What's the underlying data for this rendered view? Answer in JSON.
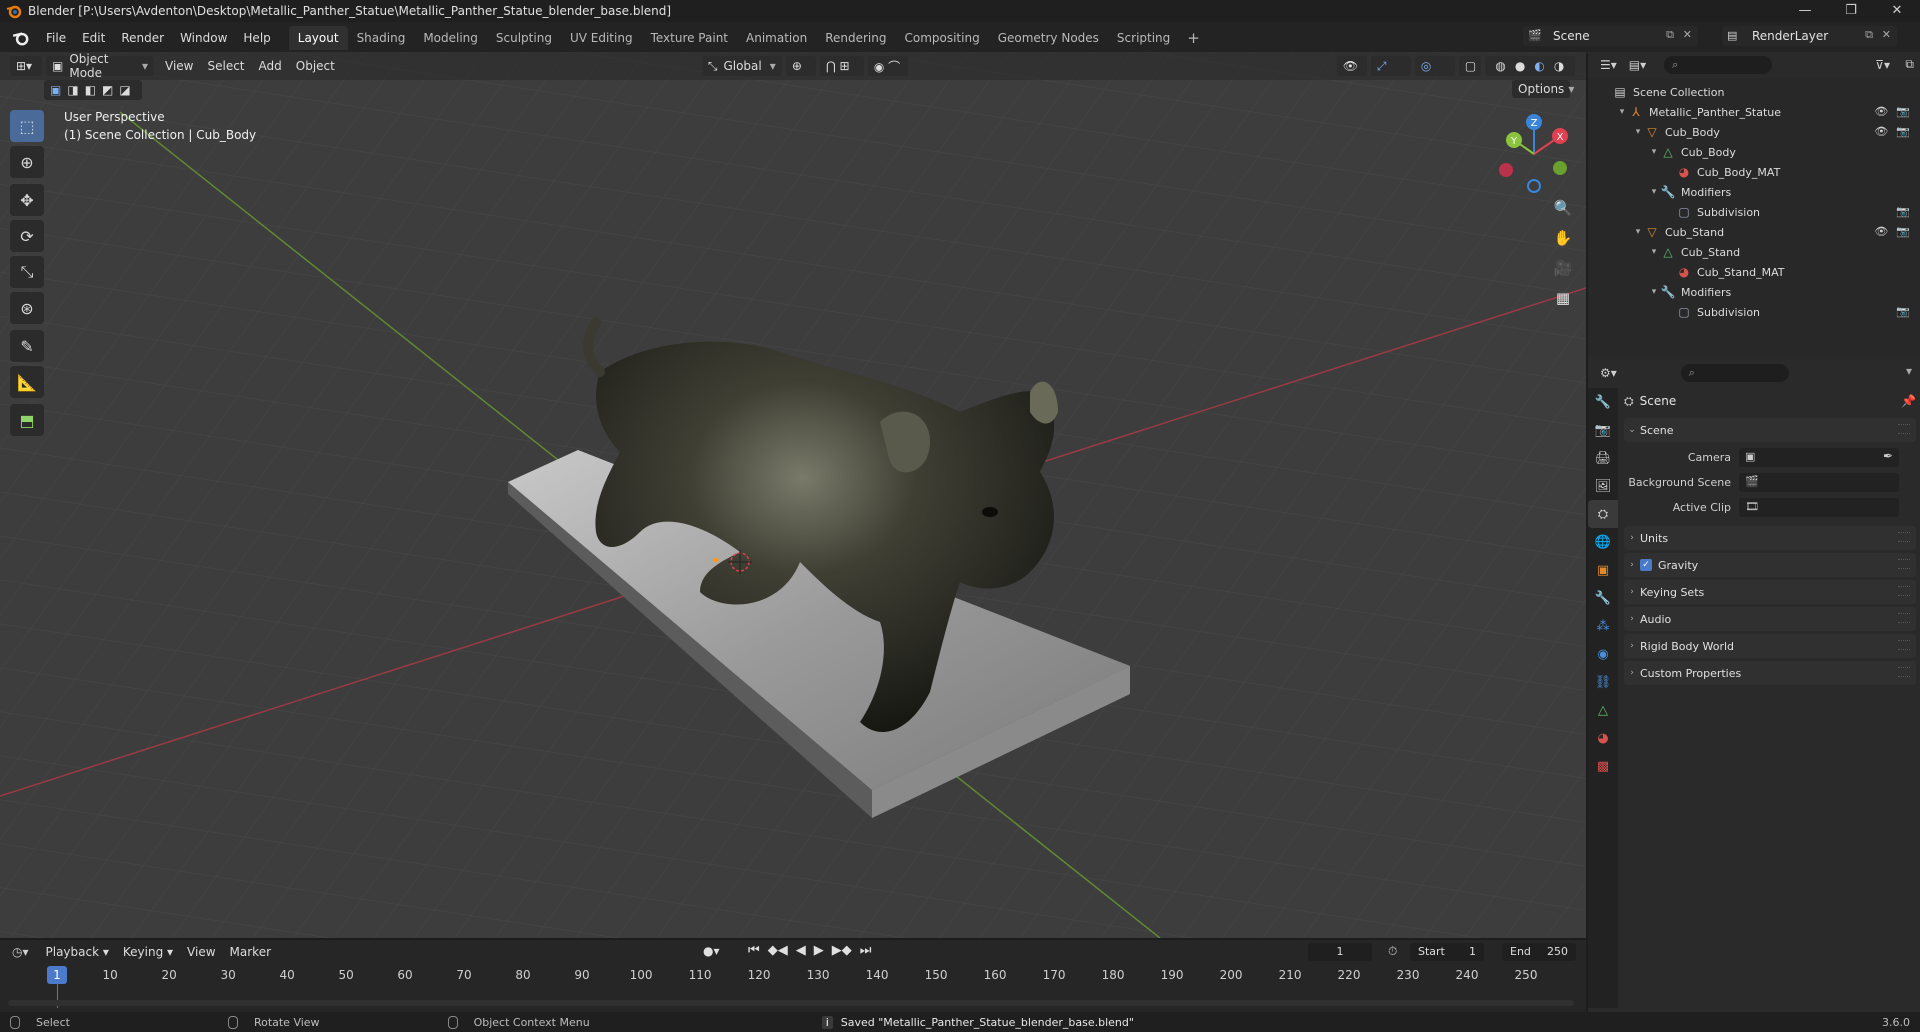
{
  "window": {
    "title": "Blender [P:\\Users\\Avdenton\\Desktop\\Metallic_Panther_Statue\\Metallic_Panther_Statue_blender_base.blend]",
    "controls": [
      "—",
      "❐",
      "✕"
    ]
  },
  "menu": [
    "File",
    "Edit",
    "Render",
    "Window",
    "Help"
  ],
  "workspaces": [
    {
      "label": "Layout",
      "active": true
    },
    {
      "label": "Shading",
      "active": false
    },
    {
      "label": "Modeling",
      "active": false
    },
    {
      "label": "Sculpting",
      "active": false
    },
    {
      "label": "UV Editing",
      "active": false
    },
    {
      "label": "Texture Paint",
      "active": false
    },
    {
      "label": "Animation",
      "active": false
    },
    {
      "label": "Rendering",
      "active": false
    },
    {
      "label": "Compositing",
      "active": false
    },
    {
      "label": "Geometry Nodes",
      "active": false
    },
    {
      "label": "Scripting",
      "active": false
    }
  ],
  "add_workspace": "+",
  "scene_selector": "Scene",
  "renderlayer_selector": "RenderLayer",
  "viewport": {
    "mode": "Object Mode",
    "menus": [
      "View",
      "Select",
      "Add",
      "Object"
    ],
    "transform_orientation": "Global",
    "options_label": "Options",
    "perspective_label": "User Perspective",
    "collection_label": "(1) Scene Collection | Cub_Body",
    "gizmo": {
      "x": "X",
      "y": "Y",
      "z": "Z"
    }
  },
  "outliner": {
    "root": "Scene Collection",
    "items": [
      {
        "label": "Metallic_Panther_Statue",
        "depth": 1,
        "icon": "empty-icon",
        "vis": true
      },
      {
        "label": "Cub_Body",
        "depth": 2,
        "icon": "mesh-object-icon",
        "vis": true
      },
      {
        "label": "Cub_Body",
        "depth": 3,
        "icon": "mesh-data-icon",
        "vis": false
      },
      {
        "label": "Cub_Body_MAT",
        "depth": 4,
        "icon": "material-icon",
        "vis": false
      },
      {
        "label": "Modifiers",
        "depth": 3,
        "icon": "wrench-icon",
        "vis": false
      },
      {
        "label": "Subdivision",
        "depth": 4,
        "icon": "subdivision-icon",
        "vis": "camera"
      },
      {
        "label": "Cub_Stand",
        "depth": 2,
        "icon": "mesh-object-icon",
        "vis": true
      },
      {
        "label": "Cub_Stand",
        "depth": 3,
        "icon": "mesh-data-icon",
        "vis": false
      },
      {
        "label": "Cub_Stand_MAT",
        "depth": 4,
        "icon": "material-icon",
        "vis": false
      },
      {
        "label": "Modifiers",
        "depth": 3,
        "icon": "wrench-icon",
        "vis": false
      },
      {
        "label": "Subdivision",
        "depth": 4,
        "icon": "subdivision-icon",
        "vis": "camera"
      }
    ]
  },
  "properties": {
    "context_title": "Scene",
    "scene_panel": {
      "header": "Scene",
      "rows": [
        {
          "label": "Camera",
          "value": ""
        },
        {
          "label": "Background Scene",
          "value": ""
        },
        {
          "label": "Active Clip",
          "value": ""
        }
      ]
    },
    "sections": [
      {
        "label": "Units",
        "checkbox": false
      },
      {
        "label": "Gravity",
        "checkbox": true
      },
      {
        "label": "Keying Sets",
        "checkbox": false
      },
      {
        "label": "Audio",
        "checkbox": false
      },
      {
        "label": "Rigid Body World",
        "checkbox": false
      },
      {
        "label": "Custom Properties",
        "checkbox": false
      }
    ]
  },
  "timeline": {
    "menus": [
      "Playback",
      "Keying",
      "View",
      "Marker"
    ],
    "current_frame": "1",
    "start_label": "Start",
    "start": "1",
    "end_label": "End",
    "end": "250",
    "ruler": [
      "1",
      "10",
      "20",
      "30",
      "40",
      "50",
      "60",
      "70",
      "80",
      "90",
      "100",
      "110",
      "120",
      "130",
      "140",
      "150",
      "160",
      "170",
      "180",
      "190",
      "200",
      "210",
      "220",
      "230",
      "240",
      "250"
    ]
  },
  "status": {
    "select": "Select",
    "rotate": "Rotate View",
    "context": "Object Context Menu",
    "message": "Saved \"Metallic_Panther_Statue_blender_base.blend\"",
    "version": "3.6.0"
  },
  "colors": {
    "accent": "#4a7ac9",
    "x_axis": "#e0404f",
    "y_axis": "#8ac43d",
    "z_axis": "#3a85d8"
  }
}
